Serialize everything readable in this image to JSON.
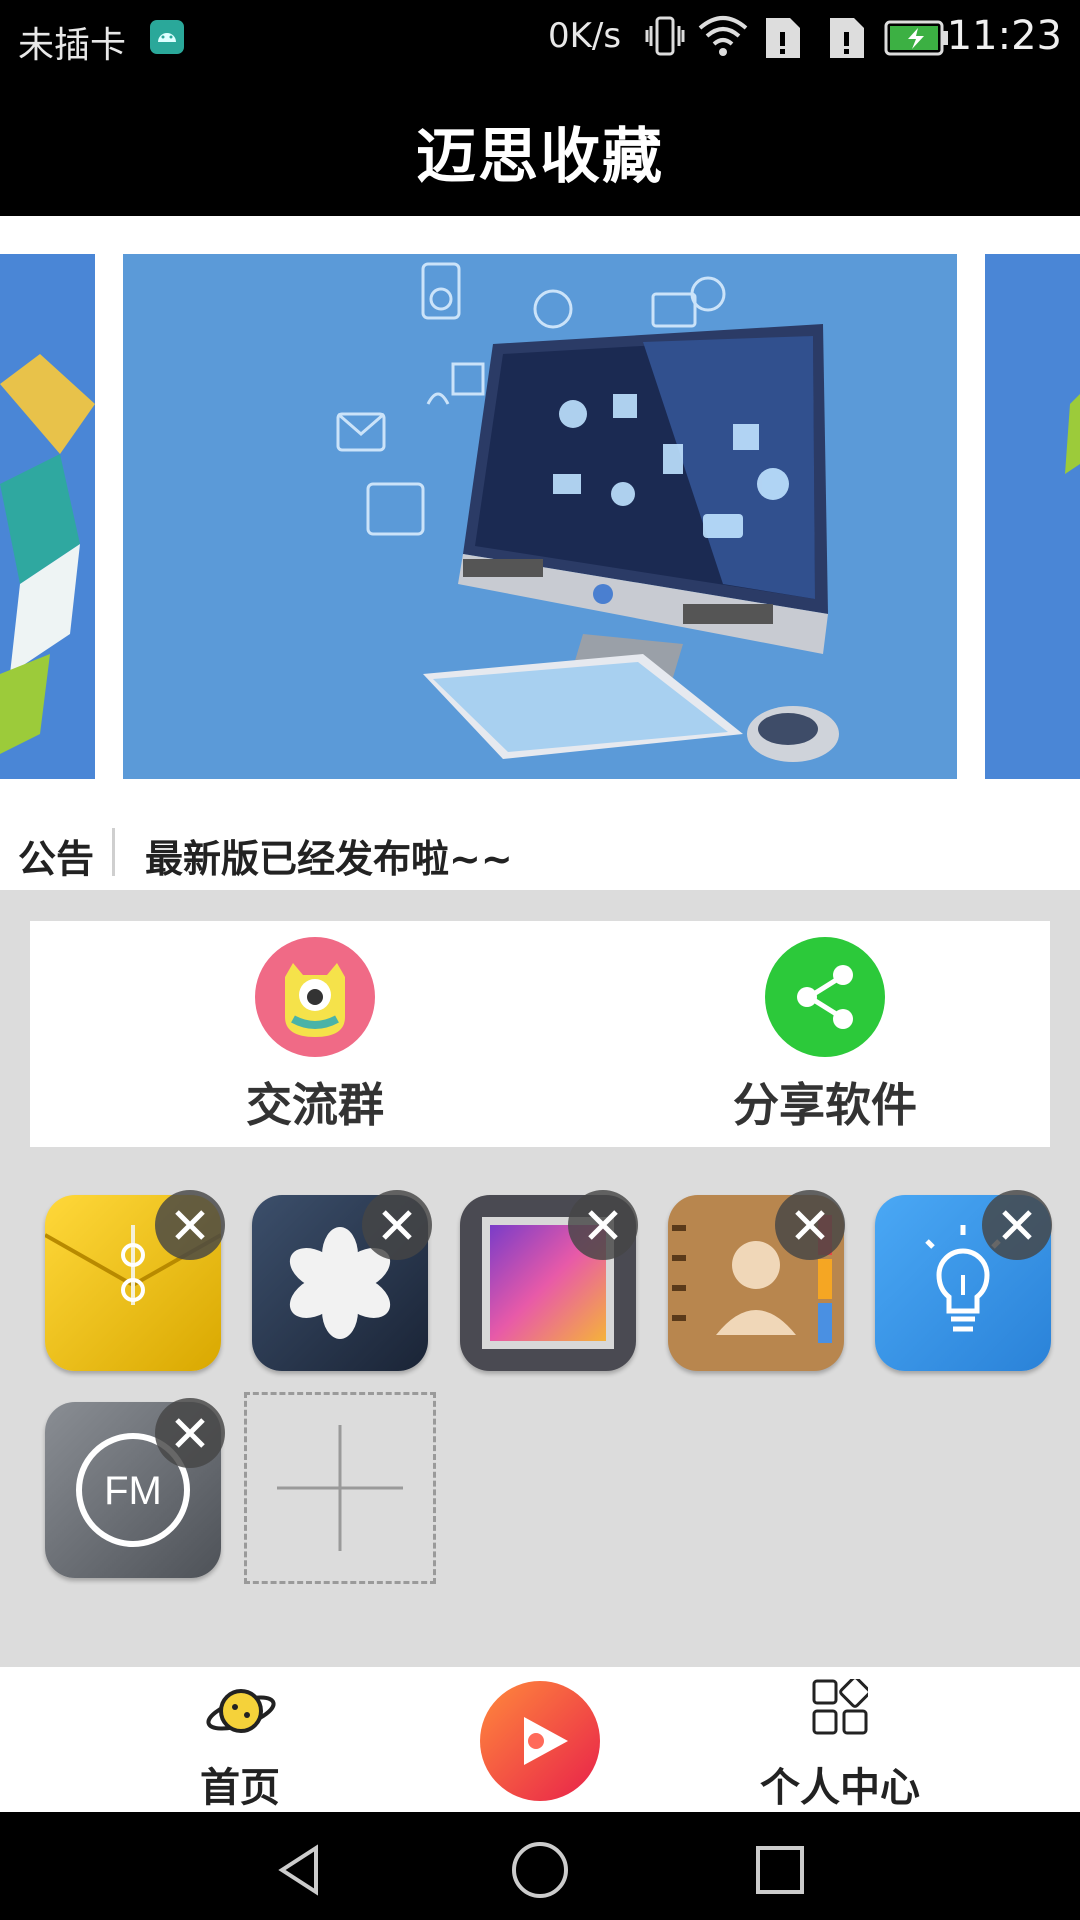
{
  "status_bar": {
    "carrier": "未插卡",
    "network_speed": "0K/s",
    "time": "11:23",
    "icons": [
      "android-notification-icon",
      "vibrate-icon",
      "wifi-icon",
      "sim1-icon",
      "sim2-icon",
      "battery-charging-icon"
    ]
  },
  "header": {
    "title": "迈思收藏"
  },
  "banner": {
    "slides": [
      "computer-illustration"
    ]
  },
  "notice": {
    "label": "公告",
    "text": "最新版已经发布啦~~"
  },
  "quick_actions": [
    {
      "label": "交流群",
      "icon": "monster-icon",
      "color": "#f06a86"
    },
    {
      "label": "分享软件",
      "icon": "share-icon",
      "color": "#2cc93a"
    }
  ],
  "apps": [
    {
      "icon": "file-manager-icon"
    },
    {
      "icon": "pinwheel-icon"
    },
    {
      "icon": "gallery-icon"
    },
    {
      "icon": "contacts-icon"
    },
    {
      "icon": "tips-lightbulb-icon"
    },
    {
      "icon": "fm-radio-icon"
    }
  ],
  "bottom_nav": {
    "items": [
      {
        "label": "首页",
        "icon": "planet-icon"
      },
      {
        "label": "",
        "icon": "video-play-icon"
      },
      {
        "label": "个人中心",
        "icon": "grid-icon"
      }
    ]
  },
  "system_nav": [
    "back-icon",
    "home-icon",
    "recents-icon"
  ],
  "colors": {
    "accent": "#000000",
    "background": "#dcdcdc"
  }
}
